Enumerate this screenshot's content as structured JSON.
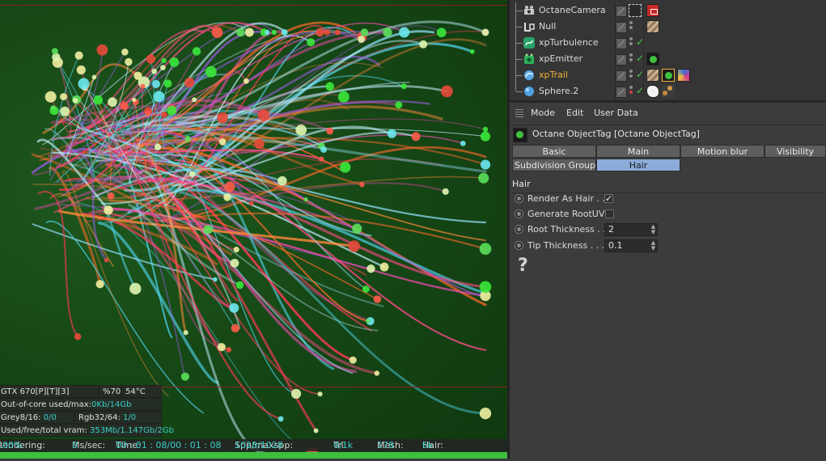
{
  "viewport": {
    "stats": {
      "gpu": "GTX 670[P][T][3]",
      "gpu_usage": "%70",
      "gpu_temp": "54°C",
      "out_of_core_label": "Out-of-core used/max:",
      "out_of_core_value": "0Kb/14Gb",
      "grey_label": "Grey8/16:",
      "grey_value": "0/0",
      "rgb_label": "Rgb32/64:",
      "rgb_value": "1/0",
      "vram_label": "Used/free/total vram:",
      "vram_value": "353Mb/1.147Gb/2Gb"
    },
    "render_bar": {
      "rendering_label": "Rendering:",
      "rendering_value": "100%",
      "ms_label": "Ms/sec:",
      "ms_value": "0",
      "time_label": "Time:",
      "time_value": "00 : 01 : 08/00 : 01 : 08",
      "spp_label": "Spp/maxspp:",
      "spp_value": "1028/1028",
      "tri_label": "Tri:",
      "tri_value": "0/1k",
      "mesh_label": "Mesh:",
      "mesh_value": "178",
      "hair_label": "Hair:",
      "hair_value": "6k"
    },
    "progress": 1.0
  },
  "objects": [
    {
      "name": "OctaneCamera",
      "icon": "camera-icon",
      "active": false
    },
    {
      "name": "Null",
      "icon": "null-icon",
      "active": false
    },
    {
      "name": "xpTurbulence",
      "icon": "turbulence-icon",
      "active": false
    },
    {
      "name": "xpEmitter",
      "icon": "emitter-icon",
      "active": false
    },
    {
      "name": "xpTrail",
      "icon": "trail-icon",
      "active": true
    },
    {
      "name": "Sphere.2",
      "icon": "sphere-icon",
      "active": false
    }
  ],
  "attributes": {
    "menu": [
      "Mode",
      "Edit",
      "User Data"
    ],
    "tag_title": "Octane ObjectTag [Octane ObjectTag]",
    "tabs_row1": [
      "Basic",
      "Main",
      "Motion blur",
      "Visibility"
    ],
    "tabs_row2_label": "Subdivision Group",
    "tabs_row2_active": "Hair",
    "section": "Hair",
    "props": {
      "render_as_hair": "Render As Hair . .",
      "render_as_hair_checked": true,
      "generate_rootuv": "Generate RootUV",
      "generate_rootuv_checked": false,
      "root_thickness_label": "Root Thickness . .",
      "root_thickness_value": "2",
      "tip_thickness_label": "Tip Thickness . . . .",
      "tip_thickness_value": "0.1"
    },
    "help": "?"
  },
  "colors": {
    "active_object": "#f3b43a",
    "active_tab": "#8cabd8",
    "check": "#4cc84c"
  }
}
